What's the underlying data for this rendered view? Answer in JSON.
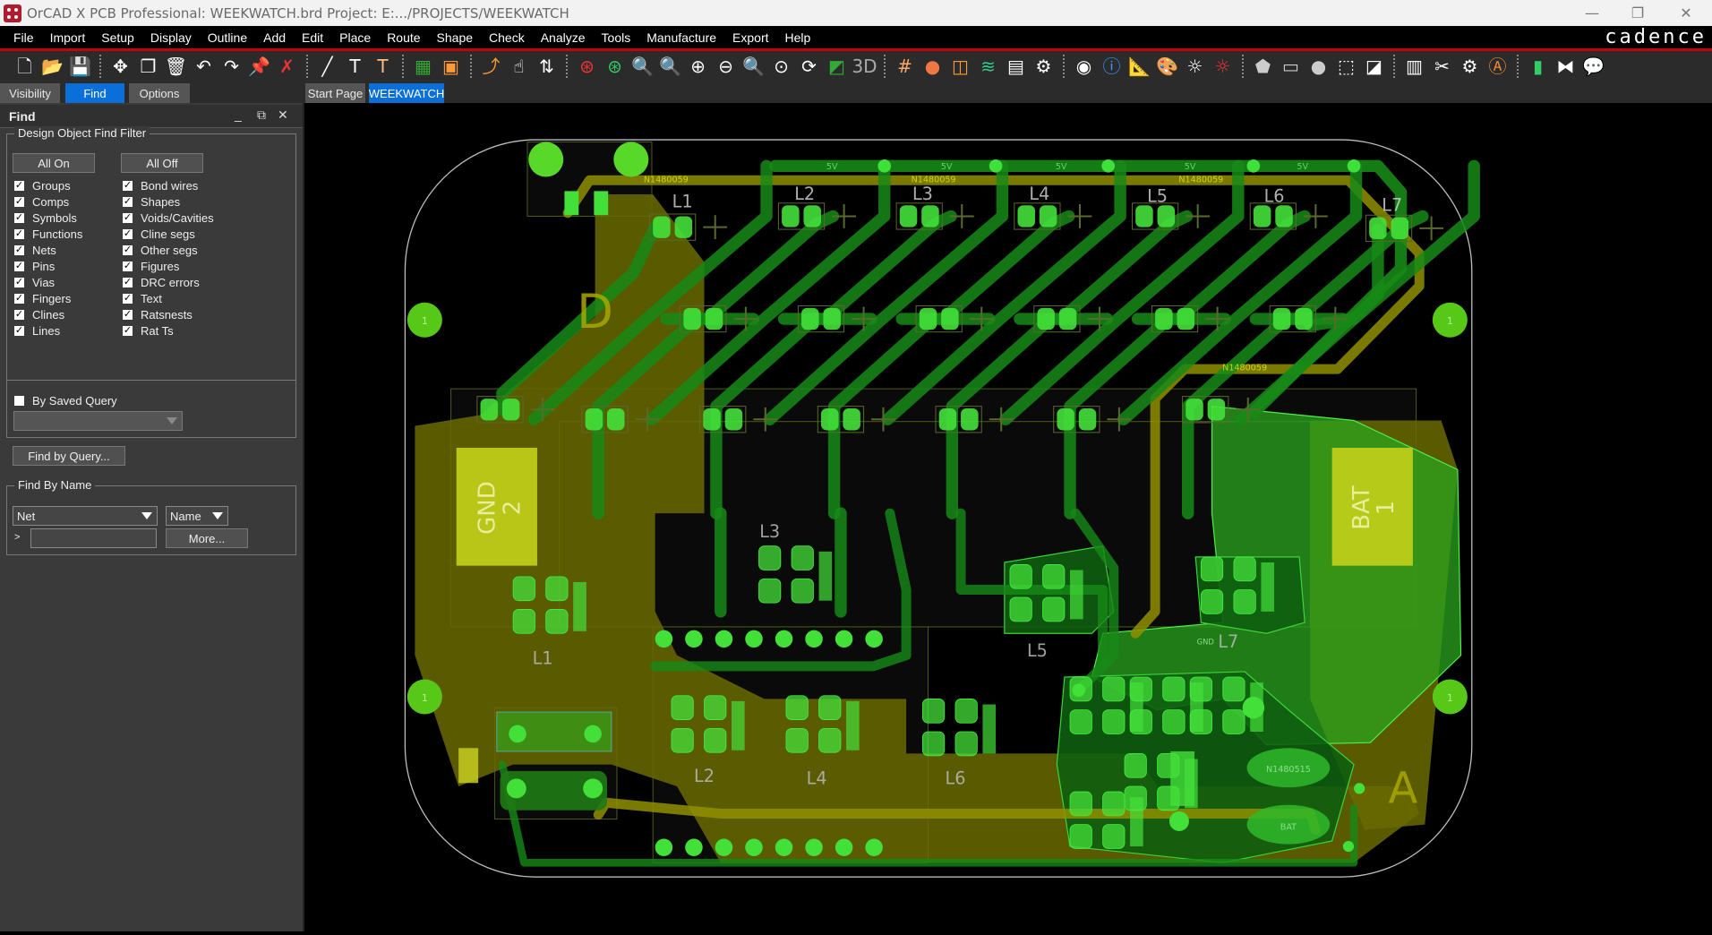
{
  "window": {
    "title": "OrCAD X PCB Professional: WEEKWATCH.brd  Project: E:.../PROJECTS/WEEKWATCH",
    "minimize": "—",
    "restore": "❐",
    "close": "✕"
  },
  "menu": [
    "File",
    "Import",
    "Setup",
    "Display",
    "Outline",
    "Add",
    "Edit",
    "Place",
    "Route",
    "Shape",
    "Check",
    "Analyze",
    "Tools",
    "Manufacture",
    "Export",
    "Help"
  ],
  "logo": "cadence",
  "toolbar": {
    "groups": [
      [
        {
          "name": "new-file-icon",
          "glyph": "🗋",
          "color": "#fff"
        },
        {
          "name": "open-folder-icon",
          "glyph": "📂",
          "color": "#d9b36c"
        },
        {
          "name": "save-icon",
          "glyph": "💾",
          "color": "#ddd"
        }
      ],
      [
        {
          "name": "move-icon",
          "glyph": "✥",
          "color": "#fff"
        },
        {
          "name": "copy-icon",
          "glyph": "❐",
          "color": "#fff"
        },
        {
          "name": "delete-icon",
          "glyph": "🗑",
          "color": "#fff"
        },
        {
          "name": "undo-icon",
          "glyph": "↶",
          "color": "#fff"
        },
        {
          "name": "redo-icon",
          "glyph": "↷",
          "color": "#fff"
        },
        {
          "name": "pin-icon",
          "glyph": "📌",
          "color": "#fff"
        },
        {
          "name": "unpin-icon",
          "glyph": "✗",
          "color": "#e33"
        }
      ],
      [
        {
          "name": "add-line-icon",
          "glyph": "╱",
          "color": "#fff"
        },
        {
          "name": "add-text-icon",
          "glyph": "T",
          "color": "#fff"
        },
        {
          "name": "edit-text-icon",
          "glyph": "T",
          "color": "#fb8"
        }
      ],
      [
        {
          "name": "place-board-icon",
          "glyph": "▦",
          "color": "#3a3"
        },
        {
          "name": "place-component-icon",
          "glyph": "▣",
          "color": "#f93"
        }
      ],
      [
        {
          "name": "route-connect-icon",
          "glyph": "⤴",
          "color": "#f93"
        },
        {
          "name": "slide-icon",
          "glyph": "☝",
          "color": "#fff"
        },
        {
          "name": "delay-tune-icon",
          "glyph": "⇅",
          "color": "#fff"
        }
      ],
      [
        {
          "name": "unrats-icon",
          "glyph": "⊛",
          "color": "#e33"
        },
        {
          "name": "rats-icon",
          "glyph": "⊛",
          "color": "#3c6"
        },
        {
          "name": "zoom-fit-icon",
          "glyph": "🔍",
          "color": "#fff"
        },
        {
          "name": "zoom-window-icon",
          "glyph": "🔍",
          "color": "#fff"
        },
        {
          "name": "zoom-in-icon",
          "glyph": "⊕",
          "color": "#fff"
        },
        {
          "name": "zoom-out-icon",
          "glyph": "⊖",
          "color": "#fff"
        },
        {
          "name": "zoom-previous-icon",
          "glyph": "🔍",
          "color": "#fff"
        },
        {
          "name": "zoom-center-icon",
          "glyph": "⊙",
          "color": "#fff"
        },
        {
          "name": "redraw-icon",
          "glyph": "⟳",
          "color": "#fff"
        },
        {
          "name": "flip-view-icon",
          "glyph": "◩",
          "color": "#3a3"
        },
        {
          "name": "3d-view-icon",
          "glyph": "3D",
          "color": "#aaa"
        }
      ],
      [
        {
          "name": "grid-icon",
          "glyph": "#",
          "color": "#fa6"
        },
        {
          "name": "color-icon",
          "glyph": "●",
          "color": "#e74"
        },
        {
          "name": "shadow-icon",
          "glyph": "◫",
          "color": "#f93"
        },
        {
          "name": "layers-icon",
          "glyph": "≋",
          "color": "#3c8"
        },
        {
          "name": "sheet-icon",
          "glyph": "▤",
          "color": "#fff"
        },
        {
          "name": "design-settings-icon",
          "glyph": "⚙",
          "color": "#fff"
        }
      ],
      [
        {
          "name": "show-element-icon",
          "glyph": "◉",
          "color": "#fff"
        },
        {
          "name": "info-icon",
          "glyph": "ⓘ",
          "color": "#39f"
        },
        {
          "name": "measure-icon",
          "glyph": "📐",
          "color": "#d9b36c"
        },
        {
          "name": "assign-color-icon",
          "glyph": "🎨",
          "color": "#fff"
        },
        {
          "name": "highlight-icon",
          "glyph": "☼",
          "color": "#fff"
        },
        {
          "name": "dehighlight-icon",
          "glyph": "☼",
          "color": "#e33"
        }
      ],
      [
        {
          "name": "add-shape-polygon-icon",
          "glyph": "⬟",
          "color": "#ccc"
        },
        {
          "name": "add-shape-rect-icon",
          "glyph": "▭",
          "color": "#ccc"
        },
        {
          "name": "add-shape-circle-icon",
          "glyph": "●",
          "color": "#ccc"
        },
        {
          "name": "select-shape-icon",
          "glyph": "⬚",
          "color": "#fff"
        },
        {
          "name": "shape-void-icon",
          "glyph": "◪",
          "color": "#fff"
        }
      ],
      [
        {
          "name": "artwork-icon",
          "glyph": "▥",
          "color": "#fff"
        },
        {
          "name": "drill-icon",
          "glyph": "✂",
          "color": "#fff"
        },
        {
          "name": "nc-parameters-icon",
          "glyph": "⚙",
          "color": "#fff"
        },
        {
          "name": "rename-icon",
          "glyph": "Ⓐ",
          "color": "#e83"
        }
      ],
      [
        {
          "name": "report-icon",
          "glyph": "▮",
          "color": "#3c6"
        },
        {
          "name": "swap-icon",
          "glyph": "⧓",
          "color": "#fff"
        },
        {
          "name": "comment-icon",
          "glyph": "💬",
          "color": "#fff"
        }
      ]
    ]
  },
  "panel_tabs": [
    "Visibility",
    "Find",
    "Options"
  ],
  "doc_tabs": [
    "Start Page",
    "WEEKWATCH"
  ],
  "find_panel": {
    "title": "Find",
    "filter_title": "Design Object Find Filter",
    "all_on": "All On",
    "all_off": "All Off",
    "left_checks": [
      {
        "label": "Groups",
        "checked": true
      },
      {
        "label": "Comps",
        "checked": true
      },
      {
        "label": "Symbols",
        "checked": true
      },
      {
        "label": "Functions",
        "checked": true
      },
      {
        "label": "Nets",
        "checked": true
      },
      {
        "label": "Pins",
        "checked": true
      },
      {
        "label": "Vias",
        "checked": true
      },
      {
        "label": "Fingers",
        "checked": true
      },
      {
        "label": "Clines",
        "checked": true
      },
      {
        "label": "Lines",
        "checked": true
      }
    ],
    "right_checks": [
      {
        "label": "Bond wires",
        "checked": true
      },
      {
        "label": "Shapes",
        "checked": true
      },
      {
        "label": "Voids/Cavities",
        "checked": true
      },
      {
        "label": "Cline segs",
        "checked": true
      },
      {
        "label": "Other segs",
        "checked": true
      },
      {
        "label": "Figures",
        "checked": true
      },
      {
        "label": "DRC errors",
        "checked": true
      },
      {
        "label": "Text",
        "checked": true
      },
      {
        "label": "Ratsnests",
        "checked": true
      },
      {
        "label": "Rat Ts",
        "checked": true
      }
    ],
    "saved_query": {
      "label": "By Saved Query",
      "checked": false,
      "value": ""
    },
    "find_by_query": "Find by Query...",
    "find_by_name_title": "Find By Name",
    "object_type": "Net",
    "name_mode": "Name",
    "prompt": ">",
    "name_value": "",
    "more": "More..."
  },
  "board": {
    "labels": [
      "L1",
      "L2",
      "L3",
      "L4",
      "L5",
      "L6",
      "L7",
      "L3",
      "L1",
      "L2",
      "L4",
      "L6",
      "L5",
      "L7",
      "N1480059",
      "N1480059",
      "N1480059",
      "N1480059",
      "5V",
      "5V",
      "5V",
      "5V",
      "5V",
      "N1480515",
      "BAT",
      "GND",
      "D",
      "A"
    ],
    "gnd_pad": {
      "net": "GND",
      "number": "2"
    },
    "bat_pad": {
      "net": "BAT",
      "number": "1"
    },
    "mount_hole": "1",
    "colors": {
      "pad": "#44e03a",
      "trace": "#178a17",
      "pour": "#0e5e10",
      "yellow_pour": "#6a6a00",
      "yellow_pad": "#c3d01a",
      "outline": "#bdbdbd"
    }
  }
}
